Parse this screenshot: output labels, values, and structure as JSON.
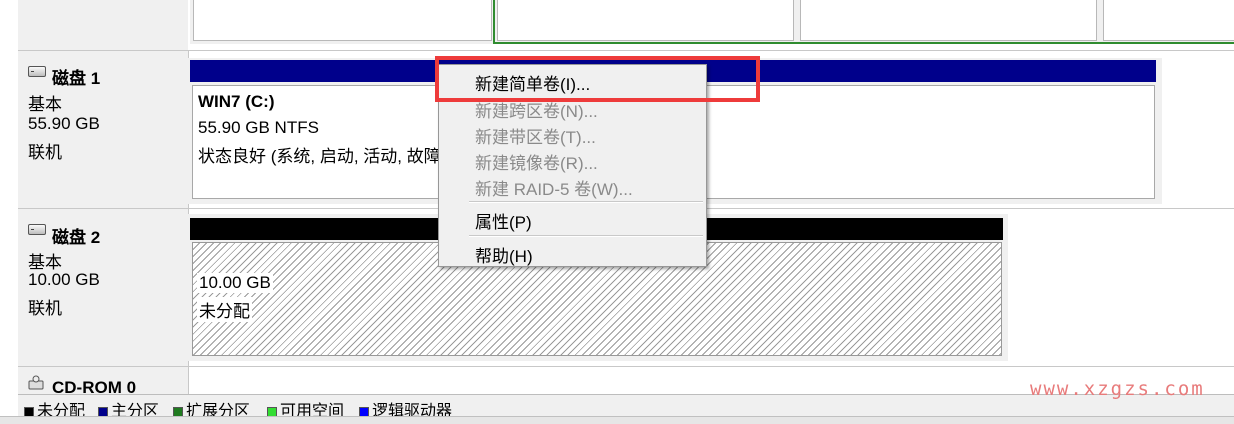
{
  "disks": [
    {
      "name": "磁盘 1",
      "type": "基本",
      "size": "55.90 GB",
      "status": "联机"
    },
    {
      "name": "磁盘 2",
      "type": "基本",
      "size": "10.00 GB",
      "status": "联机"
    }
  ],
  "cdrom": {
    "name": "CD-ROM 0"
  },
  "partition_c": {
    "name": "WIN7  (C:)",
    "size_fs": "55.90 GB NTFS",
    "status": "状态良好 (系统, 启动, 活动, 故障"
  },
  "unallocated": {
    "size": "10.00 GB",
    "label": "未分配"
  },
  "context_menu": {
    "items": [
      {
        "label": "新建简单卷(I)...",
        "enabled": true
      },
      {
        "label": "新建跨区卷(N)...",
        "enabled": false
      },
      {
        "label": "新建带区卷(T)...",
        "enabled": false
      },
      {
        "label": "新建镜像卷(R)...",
        "enabled": false
      },
      {
        "label": "新建 RAID-5 卷(W)...",
        "enabled": false
      },
      {
        "label": "属性(P)",
        "enabled": true
      },
      {
        "label": "帮助(H)",
        "enabled": true
      }
    ]
  },
  "legend": [
    {
      "label": "未分配",
      "color": "#000000"
    },
    {
      "label": "主分区",
      "color": "#00008b"
    },
    {
      "label": "扩展分区",
      "color": "#1f7a1f"
    },
    {
      "label": "可用空间",
      "color": "#33dd33"
    },
    {
      "label": "逻辑驱动器",
      "color": "#0000ff"
    }
  ],
  "watermark": "www.xzgzs.com",
  "colors": {
    "highlight": "#ee3b3b",
    "primary_partition": "#00008b",
    "extended_partition_border": "#2f8c2f"
  }
}
